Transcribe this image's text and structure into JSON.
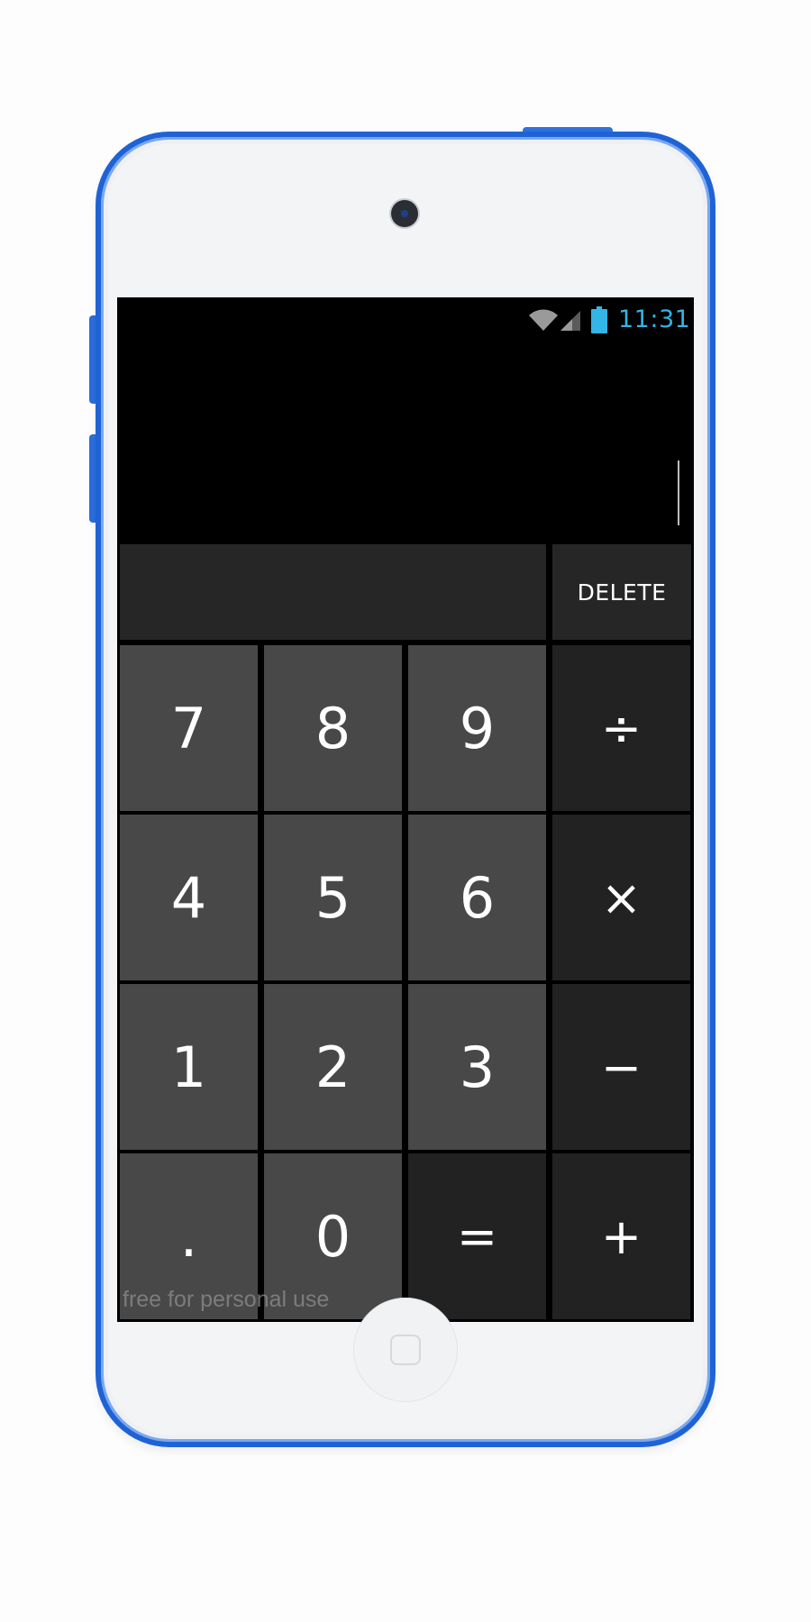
{
  "status_bar": {
    "time": "11:31",
    "wifi_icon": "wifi-icon",
    "signal_icon": "cell-signal-icon",
    "battery_icon": "battery-icon",
    "accent_color": "#33b5e5"
  },
  "display": {
    "value": ""
  },
  "controls": {
    "delete_label": "DELETE"
  },
  "keypad": {
    "key_7": "7",
    "key_8": "8",
    "key_9": "9",
    "key_divide": "÷",
    "key_4": "4",
    "key_5": "5",
    "key_6": "6",
    "key_multiply": "×",
    "key_1": "1",
    "key_2": "2",
    "key_3": "3",
    "key_minus": "−",
    "key_dot": ".",
    "key_0": "0",
    "key_equals": "=",
    "key_plus": "+"
  },
  "watermark": "free for personal use",
  "colors": {
    "device_frame": "#1e63d6",
    "number_key": "#484848",
    "operator_key": "#222222",
    "screen_bg": "#000000"
  }
}
